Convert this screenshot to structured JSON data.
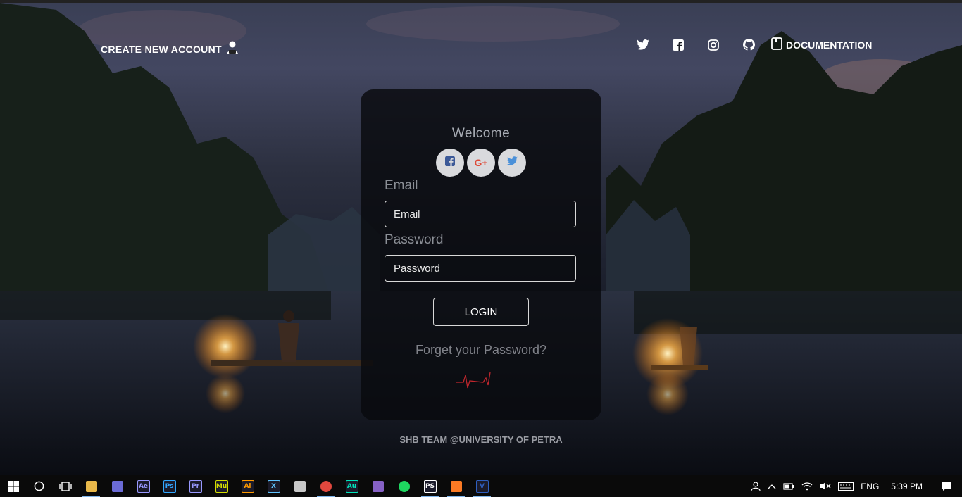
{
  "header": {
    "create_account_label": "CREATE NEW ACCOUNT",
    "documentation_label": "DOCUMENTATION",
    "social_icons": [
      "twitter-icon",
      "facebook-icon",
      "instagram-icon",
      "github-icon"
    ]
  },
  "card": {
    "welcome": "Welcome",
    "social_buttons": [
      "facebook",
      "google-plus",
      "twitter"
    ],
    "google_plus_glyph": "G+",
    "email_label": "Email",
    "email_placeholder": "Email",
    "password_label": "Password",
    "password_placeholder": "Password",
    "login_label": "LOGIN",
    "forget_label": "Forget your Password?"
  },
  "footer": {
    "text": "SHB TEAM @UNIVERSITY OF PETRA"
  },
  "taskbar": {
    "apps": [
      {
        "name": "file-explorer",
        "glyph": "",
        "color": "#e8b84a",
        "active": true
      },
      {
        "name": "app",
        "glyph": "",
        "color": "#6b6bd6",
        "active": false
      },
      {
        "name": "after-effects",
        "glyph": "Ae",
        "color": "#9999ff",
        "active": false
      },
      {
        "name": "photoshop",
        "glyph": "Ps",
        "color": "#31a8ff",
        "active": false
      },
      {
        "name": "premiere",
        "glyph": "Pr",
        "color": "#9999ff",
        "active": false
      },
      {
        "name": "muse",
        "glyph": "Mu",
        "color": "#d4dd00",
        "active": false
      },
      {
        "name": "illustrator",
        "glyph": "Ai",
        "color": "#ff9a00",
        "active": false
      },
      {
        "name": "xd",
        "glyph": "X",
        "color": "#5fc3ff",
        "active": false
      },
      {
        "name": "app2",
        "glyph": "",
        "color": "#c8c8c8",
        "active": false
      },
      {
        "name": "chrome",
        "glyph": "",
        "color": "#e0483e",
        "active": true
      },
      {
        "name": "audition",
        "glyph": "Au",
        "color": "#00e4bb",
        "active": false
      },
      {
        "name": "visual-studio",
        "glyph": "",
        "color": "#8661c5",
        "active": false
      },
      {
        "name": "spotify",
        "glyph": "",
        "color": "#1ed760",
        "active": false
      },
      {
        "name": "phpstorm",
        "glyph": "PS",
        "color": "#ffffff",
        "active": true
      },
      {
        "name": "xampp",
        "glyph": "",
        "color": "#fb7a24",
        "active": true
      },
      {
        "name": "visual-paradigm",
        "glyph": "V",
        "color": "#2f5fbf",
        "active": true
      }
    ],
    "language": "ENG",
    "time": "5:39 PM"
  }
}
